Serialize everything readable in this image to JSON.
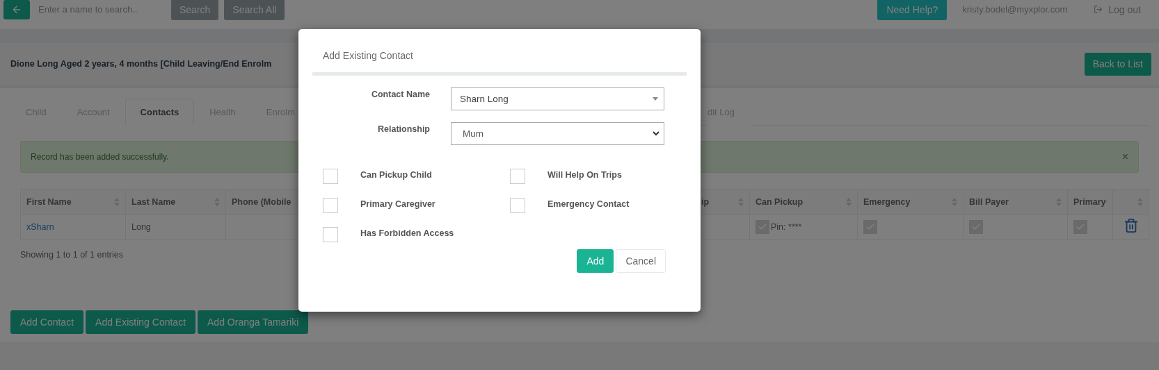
{
  "top_bar": {
    "search": {
      "placeholder": "Enter a name to search.."
    },
    "buttons": [
      "Search",
      "Search All"
    ],
    "help_button": "Need Help?",
    "user_email": "kristy.bodel@myxplor.com",
    "logout": "Log out"
  },
  "header": {
    "title": "Dione Long Aged 2 years, 4 months [Child Leaving/End Enrolm",
    "back_button": "Back to List"
  },
  "tabs": [
    {
      "label": "Child",
      "selected": false
    },
    {
      "label": "Account",
      "selected": false
    },
    {
      "label": "Contacts",
      "selected": true
    },
    {
      "label": "Health",
      "selected": false
    },
    {
      "label": "Enrolm",
      "selected": false
    },
    {
      "label": "dit Log",
      "selected": false
    }
  ],
  "alert": {
    "message": "Record has been added successfully.",
    "close": "×"
  },
  "table": {
    "columns": [
      {
        "label": "First Name",
        "sorted": false
      },
      {
        "label": "Last Name",
        "sorted": false
      },
      {
        "label": "Phone (Mobile"
      },
      {
        "label": "ip",
        "sorted": false
      },
      {
        "label": "Can Pickup",
        "sorted": false
      },
      {
        "label": "Emergency",
        "sorted": false
      },
      {
        "label": "Bill Payer",
        "sorted": false
      },
      {
        "label": "Primary",
        "sorted": true
      },
      {
        "sorted": false
      }
    ],
    "rows": [
      {
        "cells": [
          {
            "kind": "link",
            "text": "xSharn"
          },
          {
            "kind": "text",
            "text": "Long"
          },
          {
            "kind": "empty"
          },
          {
            "kind": "empty"
          },
          {
            "kind": "check",
            "checked": true,
            "text": "Pin: ****"
          },
          {
            "kind": "check",
            "checked": true
          },
          {
            "kind": "check",
            "checked": true
          },
          {
            "kind": "check",
            "checked": true
          },
          {
            "kind": "delete"
          }
        ]
      }
    ]
  },
  "table_info": "Showing 1 to 1 of 1 entries",
  "actions": [
    "Add Contact",
    "Add Existing Contact",
    "Add Oranga Tamariki"
  ],
  "modal": {
    "title": "Add Existing Contact",
    "fields": [
      {
        "label": "Contact Name",
        "kind": "combo",
        "value": "Sharn Long"
      },
      {
        "label": "Relationship",
        "kind": "select",
        "value": "Mum"
      }
    ],
    "options": [
      {
        "label": "Can Pickup Child",
        "checked": false
      },
      {
        "label": "Will Help On Trips",
        "checked": false
      },
      {
        "label": "Primary Caregiver",
        "checked": false
      },
      {
        "label": "Emergency Contact",
        "checked": false
      },
      {
        "label": "Has Forbidden Access",
        "checked": false
      }
    ],
    "buttons": [
      {
        "label": "Add",
        "kind": "primary"
      },
      {
        "label": "Cancel",
        "kind": "default"
      }
    ]
  }
}
